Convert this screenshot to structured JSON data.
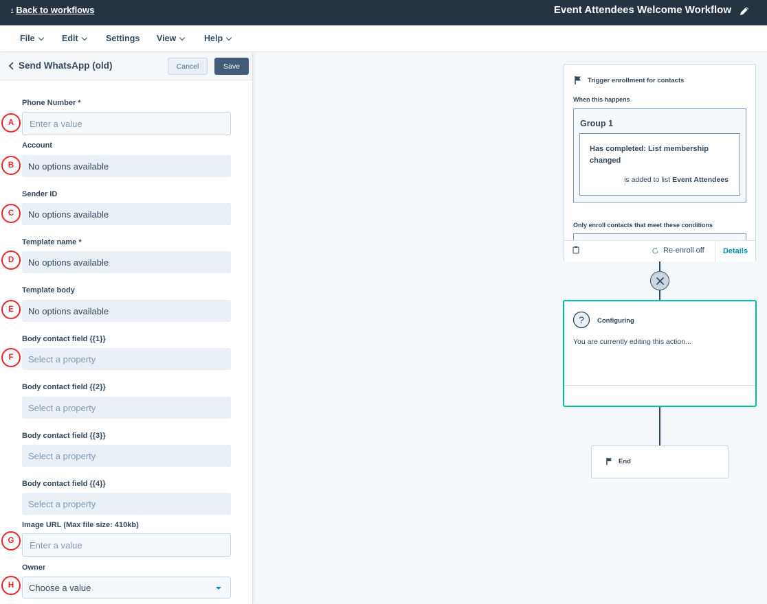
{
  "topbar": {
    "back_label": "Back to workflows",
    "workflow_title": "Event Attendees Welcome Workflow"
  },
  "menu": {
    "file": "File",
    "edit": "Edit",
    "settings": "Settings",
    "view": "View",
    "help": "Help"
  },
  "panel": {
    "title": "Send WhatsApp (old)",
    "cancel_label": "Cancel",
    "save_label": "Save",
    "fields": [
      {
        "label": "Phone Number *",
        "placeholder": "Enter a value",
        "marker": "A"
      },
      {
        "label": "Account",
        "value": "No options available",
        "marker": "B"
      },
      {
        "label": "Sender ID",
        "value": "No options available",
        "marker": "C"
      },
      {
        "label": "Template name *",
        "value": "No options available",
        "marker": "D"
      },
      {
        "label": "Template body",
        "value": "No options available",
        "marker": "E"
      },
      {
        "label": "Body contact field {{1}}",
        "placeholder": "Select a property",
        "marker": "F"
      },
      {
        "label": "Body contact field {{2}}",
        "placeholder": "Select a property"
      },
      {
        "label": "Body contact field {{3}}",
        "placeholder": "Select a property"
      },
      {
        "label": "Body contact field {{4}}",
        "placeholder": "Select a property"
      },
      {
        "label": "Image URL (Max file size: 410kb)",
        "placeholder": "Enter a value",
        "marker": "G"
      },
      {
        "label": "Owner",
        "value": "Choose a value",
        "marker": "H"
      }
    ]
  },
  "canvas": {
    "trigger": {
      "title": "Trigger enrollment for contacts",
      "when_label": "When this happens",
      "group_title": "Group 1",
      "condition_title": "Has completed: List membership changed",
      "condition_text": "is added to list",
      "condition_list": "Event Attendees",
      "only_label": "Only enroll contacts that meet these conditions",
      "reenroll_label": "Re-enroll off",
      "details_label": "Details"
    },
    "configuring": {
      "title": "Configuring",
      "message": "You are currently editing this action..."
    },
    "end": {
      "label": "End"
    }
  },
  "colors": {
    "topbar": "#253342",
    "accent_teal": "#00bda5",
    "link": "#0091ae",
    "marker_red": "#e8262b",
    "save_button": "#425b76"
  },
  "icons": {
    "back": "chevron-left-icon",
    "edit": "pencil-icon",
    "flag": "flag-icon",
    "clipboard": "clipboard-icon",
    "reenroll": "refresh-icon",
    "delete": "close-icon",
    "help": "question-icon"
  }
}
